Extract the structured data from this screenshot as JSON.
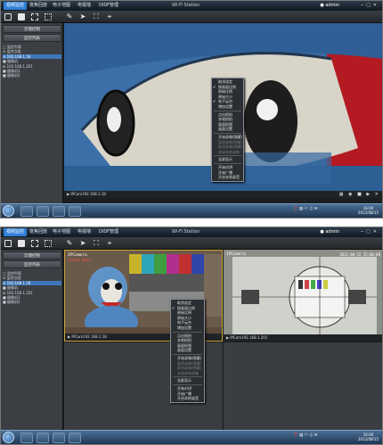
{
  "app": {
    "tabs": [
      "视频监控",
      "变焦回放",
      "电子地图",
      "电视墙",
      "DIDF管理"
    ],
    "window_title": "Wi-Fi Station",
    "user": "admin"
  },
  "sidebar": {
    "buttons": [
      "云镜控制",
      "监控列表"
    ],
    "tree_1": [
      "□ 监控列表",
      "⊟ 监控点组",
      "  ⊟ 192.168.1.18",
      "    ■ 摄像机",
      "  ⊞ 192.168.1.201",
      "    ■ 摄像机1",
      "    ■ 摄像机2"
    ],
    "tree_2": [
      "□ 监控列表",
      "⊟ 监控点组",
      "  ⊟ 192.168.1.18",
      "    ■ 摄像机",
      "  ⊞ 192.168.1.201",
      "    ■ 摄像机1",
      "    ■ 摄像机2"
    ]
  },
  "video": {
    "status_1": "IPCam192.168.1.18",
    "status_2": "IPCamera",
    "cam_left_label": "IPCamera",
    "cam_left_sub": "Alarm Bell",
    "cam_right_label": "IPCamera",
    "cam_right_time": "2012-08-15 15:00:00",
    "status_left": "IPCam192.168.1.18",
    "status_right": "IPCam192.168.1.201"
  },
  "context_menu": {
    "items": [
      {
        "label": "取消选定",
        "state": "normal"
      },
      {
        "label": "按画面比例",
        "state": "checked"
      },
      {
        "label": "原始比例",
        "state": "normal"
      },
      {
        "label": "原始大小",
        "state": "normal"
      },
      {
        "label": "电子云台",
        "state": "checked"
      },
      {
        "label": "增加设置",
        "state": "normal"
      },
      {
        "label": "sep",
        "state": "sep"
      },
      {
        "label": "点击抓拍",
        "state": "normal"
      },
      {
        "label": "本地抓拍",
        "state": "normal"
      },
      {
        "label": "画面抓图",
        "state": "normal"
      },
      {
        "label": "画面设置",
        "state": "normal"
      },
      {
        "label": "sep",
        "state": "sep"
      },
      {
        "label": "开始录像(隐藏)",
        "state": "normal"
      },
      {
        "label": "暂停录像(隐藏)",
        "state": "disabled"
      },
      {
        "label": "取消录像(隐藏)",
        "state": "disabled"
      },
      {
        "label": "关闭本地录像",
        "state": "disabled"
      },
      {
        "label": "sep",
        "state": "sep"
      },
      {
        "label": "全屏显示",
        "state": "normal"
      },
      {
        "label": "sep",
        "state": "sep"
      },
      {
        "label": "开始对讲",
        "state": "normal"
      },
      {
        "label": "开始广播",
        "state": "normal"
      },
      {
        "label": "开启本地录音",
        "state": "normal"
      }
    ]
  },
  "taskbar": {
    "clock_time": "16:00",
    "clock_date": "2012/08/15"
  },
  "colors": {
    "accent": "#2f7fd6",
    "background": "#1b1d20",
    "menu_bg": "#2a2d31"
  }
}
